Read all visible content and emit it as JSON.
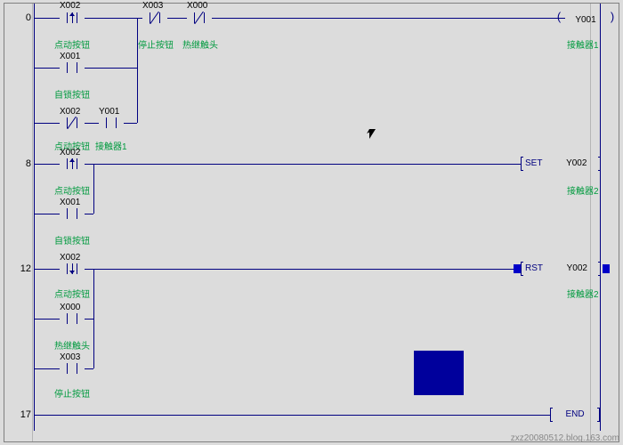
{
  "step_numbers": {
    "r0": "0",
    "r8": "8",
    "r12": "12",
    "r17": "17"
  },
  "devices": {
    "X000a": "X000",
    "X000b": "X000",
    "X001a": "X001",
    "X001b": "X001",
    "X002a": "X002",
    "X002b": "X002",
    "X002c": "X002",
    "X002d": "X002",
    "X003a": "X003",
    "X003b": "X003",
    "Y001a": "Y001",
    "Y001b": "Y001",
    "Y002a": "Y002",
    "Y002b": "Y002"
  },
  "instructions": {
    "SET": "SET",
    "RST": "RST",
    "END": "END"
  },
  "comments": {
    "c_dianDongAn1": "点动按钮",
    "c_dianDongAn2": "点动按钮",
    "c_dianDongAn3": "点动按钮",
    "c_dianDongAn4": "点动按钮",
    "c_ziSuoAn1": "自锁按钮",
    "c_ziSuoAn2": "自锁按钮",
    "c_tingZhiAn1": "停止按钮",
    "c_tingZhiAn2": "停止按钮",
    "c_reJiChu1": "热继触头",
    "c_reJiChu2": "热继触头",
    "c_jieChu1a": "接触器1",
    "c_jieChu1b": "接触器1",
    "c_jieChu2a": "接触器2",
    "c_jieChu2b": "接触器2"
  },
  "watermark": "zxz20080512.blog.163.com"
}
